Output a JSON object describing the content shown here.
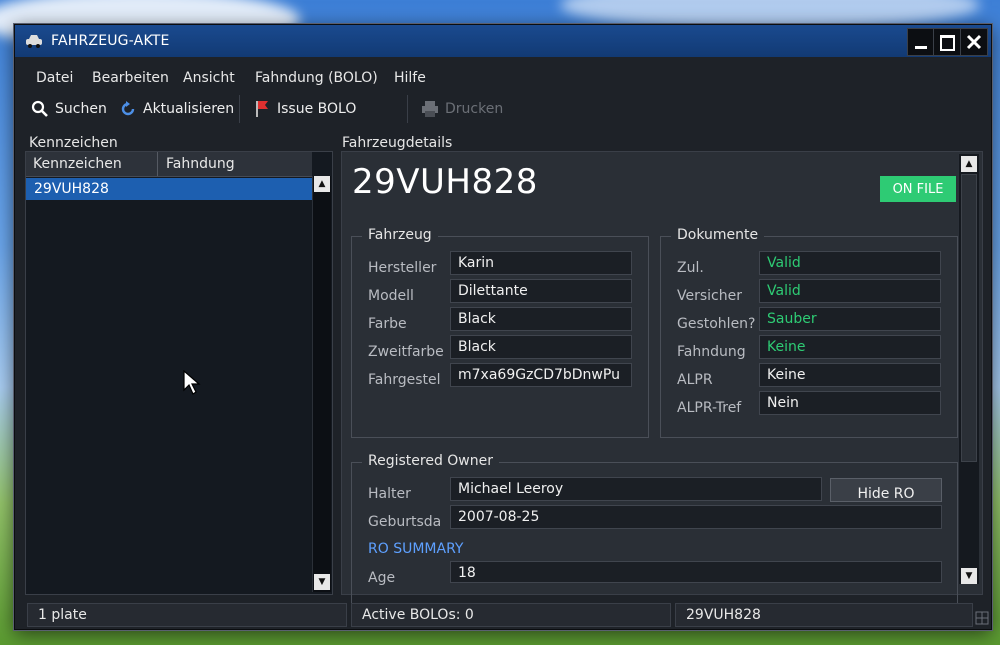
{
  "window": {
    "title": "FAHRZEUG-AKTE"
  },
  "menu": [
    "Datei",
    "Bearbeiten",
    "Ansicht",
    "Fahndung (BOLO)",
    "Hilfe"
  ],
  "toolbar": {
    "search": "Suchen",
    "refresh": "Aktualisieren",
    "issue_bolo": "Issue BOLO",
    "print": "Drucken"
  },
  "left": {
    "section": "Kennzeichen",
    "columns": [
      "Kennzeichen",
      "Fahndung"
    ],
    "rows": [
      {
        "plate": "29VUH828",
        "bolo": ""
      }
    ]
  },
  "details": {
    "section": "Fahrzeugdetails",
    "plate": "29VUH828",
    "badge": "ON FILE",
    "vehicle": {
      "title": "Fahrzeug",
      "fields": [
        {
          "label": "Hersteller",
          "value": "Karin"
        },
        {
          "label": "Modell",
          "value": "Dilettante"
        },
        {
          "label": "Farbe",
          "value": "Black"
        },
        {
          "label": "Zweitfarbe",
          "value": "Black"
        },
        {
          "label": "Fahrgestel",
          "value": "m7xa69GzCD7bDnwPu"
        }
      ]
    },
    "documents": {
      "title": "Dokumente",
      "fields": [
        {
          "label": "Zul.",
          "value": "Valid"
        },
        {
          "label": "Versicher",
          "value": "Valid"
        },
        {
          "label": "Gestohlen?",
          "value": "Sauber"
        },
        {
          "label": "Fahndung",
          "value": "Keine"
        },
        {
          "label": "ALPR",
          "value": "Keine"
        },
        {
          "label": "ALPR-Tref",
          "value": "Nein"
        }
      ]
    },
    "owner": {
      "title": "Registered Owner",
      "holder_label": "Halter",
      "holder_value": "Michael Leeroy",
      "hide_button": "Hide RO",
      "dob_label": "Geburtsda",
      "dob_value": "2007-08-25",
      "summary_link": "RO SUMMARY",
      "age_label": "Age",
      "age_value": "18"
    }
  },
  "status": {
    "count": "1 plate",
    "active": "Active BOLOs: 0",
    "plate": "29VUH828"
  },
  "colors": {
    "accent": "#1d5fb0",
    "onfile": "#2ecb74",
    "link": "#5ea0ff"
  }
}
